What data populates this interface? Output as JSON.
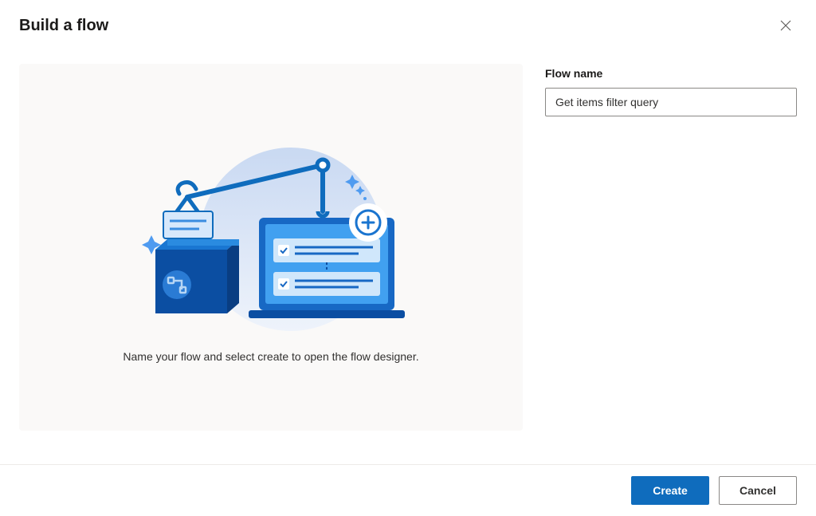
{
  "dialog": {
    "title": "Build a flow",
    "instruction": "Name your flow and select create to open the flow designer."
  },
  "form": {
    "flow_name_label": "Flow name",
    "flow_name_value": "Get items filter query"
  },
  "footer": {
    "create_label": "Create",
    "cancel_label": "Cancel"
  }
}
